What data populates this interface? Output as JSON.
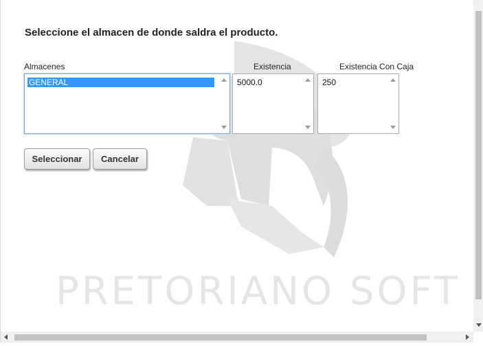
{
  "dialog": {
    "heading": "Seleccione el almacen de donde saldra el producto.",
    "watermark_text": "PRETORIANO SOFT"
  },
  "columns": {
    "almacenes": {
      "label": "Almacenes",
      "options": [
        "GENERAL"
      ],
      "selected": "GENERAL"
    },
    "existencia": {
      "label": "Existencia",
      "options": [
        "5000.0"
      ]
    },
    "existencia_caja": {
      "label": "Existencia Con Caja",
      "options": [
        "250"
      ]
    }
  },
  "buttons": {
    "select_label": "Seleccionar",
    "cancel_label": "Cancelar"
  },
  "colors": {
    "selection": "#3399ff",
    "watermark": "#e6e6e6",
    "focus_border": "#7aa7e0"
  },
  "icons": {
    "close": "close-icon",
    "watermark_logo": "spartan-helmet-icon"
  }
}
